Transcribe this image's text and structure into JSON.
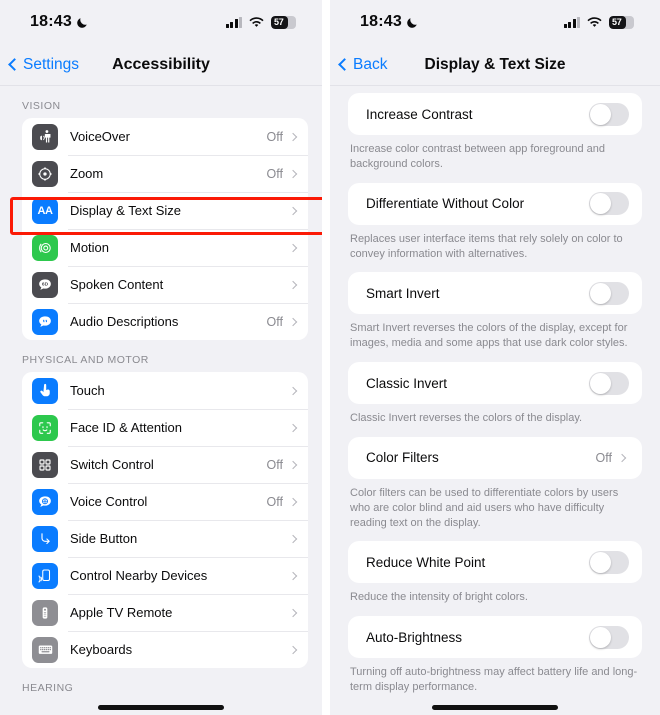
{
  "status_bar": {
    "time": "18:43",
    "moon_icon": "crescent-moon-icon",
    "battery_percent": "57",
    "cellular_icon": "cellular-bars-icon",
    "wifi_icon": "wifi-icon"
  },
  "left_screen": {
    "nav": {
      "back_label": "Settings",
      "title": "Accessibility"
    },
    "sections": [
      {
        "header": "VISION",
        "items": [
          {
            "label": "VoiceOver",
            "value": "Off",
            "icon": "voiceover-icon",
            "icon_color": "#4b4b50"
          },
          {
            "label": "Zoom",
            "value": "Off",
            "icon": "zoom-icon",
            "icon_color": "#4b4b50"
          },
          {
            "label": "Display & Text Size",
            "value": "",
            "icon": "display-text-size-icon",
            "icon_color": "#0a7cff"
          },
          {
            "label": "Motion",
            "value": "",
            "icon": "motion-icon",
            "icon_color": "#2dc84d"
          },
          {
            "label": "Spoken Content",
            "value": "",
            "icon": "spoken-content-icon",
            "icon_color": "#4b4b50"
          },
          {
            "label": "Audio Descriptions",
            "value": "Off",
            "icon": "audio-descriptions-icon",
            "icon_color": "#0a7cff"
          }
        ]
      },
      {
        "header": "PHYSICAL AND MOTOR",
        "items": [
          {
            "label": "Touch",
            "value": "",
            "icon": "touch-icon",
            "icon_color": "#0a7cff"
          },
          {
            "label": "Face ID & Attention",
            "value": "",
            "icon": "face-id-icon",
            "icon_color": "#2dc84d"
          },
          {
            "label": "Switch Control",
            "value": "Off",
            "icon": "switch-control-icon",
            "icon_color": "#4b4b50"
          },
          {
            "label": "Voice Control",
            "value": "Off",
            "icon": "voice-control-icon",
            "icon_color": "#0a7cff"
          },
          {
            "label": "Side Button",
            "value": "",
            "icon": "side-button-icon",
            "icon_color": "#0a7cff"
          },
          {
            "label": "Control Nearby Devices",
            "value": "",
            "icon": "control-nearby-devices-icon",
            "icon_color": "#0a7cff"
          },
          {
            "label": "Apple TV Remote",
            "value": "",
            "icon": "apple-tv-remote-icon",
            "icon_color": "#8e8e93"
          },
          {
            "label": "Keyboards",
            "value": "",
            "icon": "keyboards-icon",
            "icon_color": "#8e8e93"
          }
        ]
      },
      {
        "header": "HEARING",
        "items": []
      }
    ],
    "highlighted_item": "Display & Text Size"
  },
  "right_screen": {
    "nav": {
      "back_label": "Back",
      "title": "Display & Text Size"
    },
    "settings": [
      {
        "label": "Increase Contrast",
        "control": "toggle",
        "state": "off",
        "footnote": "Increase color contrast between app foreground and background colors."
      },
      {
        "label": "Differentiate Without Color",
        "control": "toggle",
        "state": "off",
        "footnote": "Replaces user interface items that rely solely on color to convey information with alternatives."
      },
      {
        "label": "Smart Invert",
        "control": "toggle",
        "state": "off",
        "footnote": "Smart Invert reverses the colors of the display, except for images, media and some apps that use dark color styles."
      },
      {
        "label": "Classic Invert",
        "control": "toggle",
        "state": "off",
        "footnote": "Classic Invert reverses the colors of the display."
      },
      {
        "label": "Color Filters",
        "control": "disclosure",
        "value": "Off",
        "footnote": "Color filters can be used to differentiate colors by users who are color blind and aid users who have difficulty reading text on the display."
      },
      {
        "label": "Reduce White Point",
        "control": "toggle",
        "state": "off",
        "footnote": "Reduce the intensity of bright colors."
      },
      {
        "label": "Auto-Brightness",
        "control": "toggle",
        "state": "off",
        "footnote": "Turning off auto-brightness may affect battery life and long-term display performance."
      }
    ],
    "highlighted_item": "Auto-Brightness"
  },
  "colors": {
    "accent_blue": "#0a7cff",
    "highlight_red": "#fb1a06",
    "page_background": "#f1f1f5",
    "card_background": "#ffffff",
    "secondary_text": "#8a8a90"
  }
}
